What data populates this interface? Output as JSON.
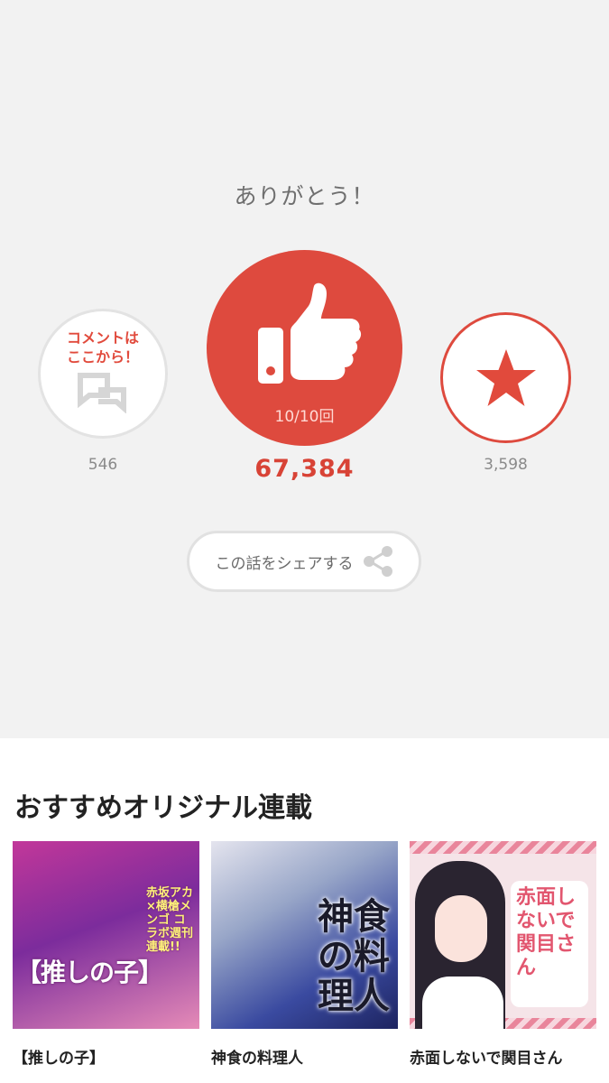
{
  "header": {
    "thanks": "ありがとう！"
  },
  "actions": {
    "comment": {
      "cta": "コメントは\nここから！",
      "count": "546"
    },
    "like": {
      "progress_label": "10/10回",
      "count": "67,384"
    },
    "favorite": {
      "count": "3,598"
    }
  },
  "share": {
    "label": "この話をシェアする"
  },
  "recommend": {
    "title": "おすすめオリジナル連載",
    "items": [
      {
        "name": "【推しの子】",
        "cover_text": "【推しの子】",
        "cover_sub": "赤坂アカ×横槍メンゴ コラボ週刊連載!!"
      },
      {
        "name": "神食の料理人",
        "cover_text": "神食の料理人"
      },
      {
        "name": "赤面しないで関目さん",
        "cover_text": "赤面しないで関目さん"
      }
    ]
  },
  "colors": {
    "accent": "#de4a3e",
    "background": "#f2f2f2"
  },
  "icons": {
    "comment": "speech-bubbles-icon",
    "like": "thumbs-up-icon",
    "favorite": "star-icon",
    "share": "share-icon"
  }
}
